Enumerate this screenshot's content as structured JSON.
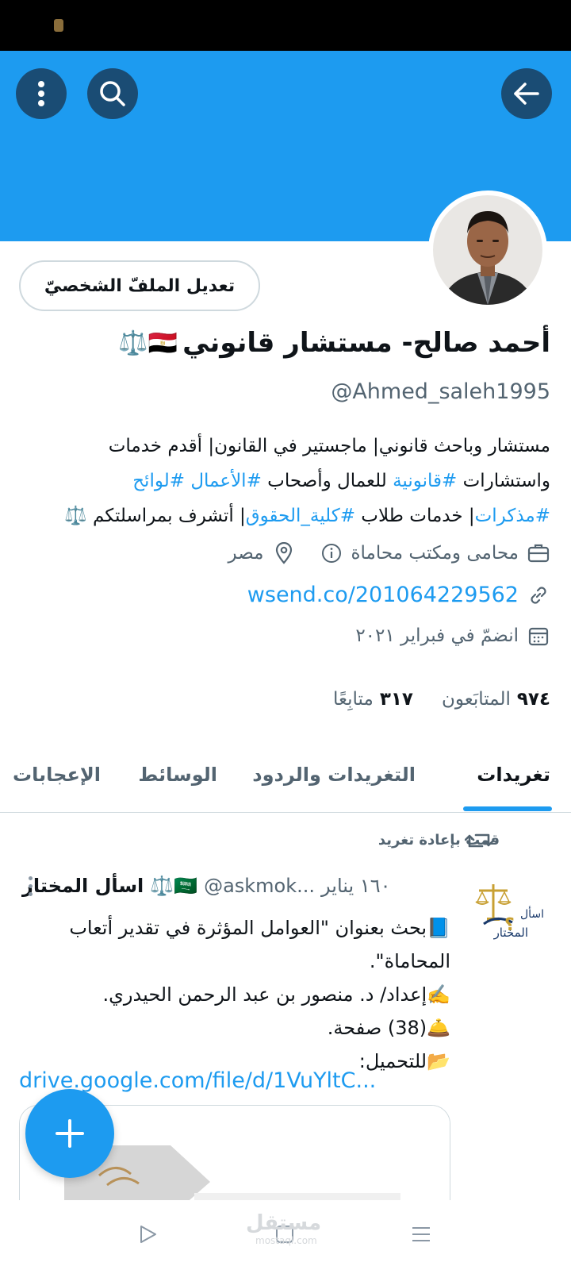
{
  "profile": {
    "name": "أحمد صالح- مستشار قانوني",
    "name_emojis": "🇪🇬⚖️",
    "handle": "@Ahmed_saleh1995",
    "edit_label": "تعديل الملفّ الشخصيّ",
    "bio_line1": "مستشار وباحث قانوني| ماجستير في القانون| أقدم خدمات",
    "bio_line2_a": "واستشارات ",
    "bio_line2_tag1": "#قانونية",
    "bio_line2_b": " للعمال وأصحاب ",
    "bio_line2_tag2": "#الأعمال",
    "bio_line2_c": " ",
    "bio_line2_tag3": "#لوائح",
    "bio_line3_tag1": "#مذكرات",
    "bio_line3_a": "| خدمات طلاب ",
    "bio_line3_tag2": "#كلية_الحقوق",
    "bio_line3_b": "| أتشرف بمراسلتكم ⚖️",
    "category": "محامى ومكتب محاماة",
    "location": "مصر",
    "link": "wsend.co/201064229562",
    "joined": "انضمّ في فبراير ٢٠٢١",
    "followers_count": "٩٧٤",
    "followers_label": "المتابَعون",
    "following_count": "٣١٧",
    "following_label": "متابِعًا"
  },
  "tabs": [
    "تغريدات",
    "التغريدات والردود",
    "الوسائط",
    "الإعجابات"
  ],
  "tweet": {
    "retweet_label": "قمت بإعادة تغريد",
    "author_name": "اسأل المختار",
    "author_emojis": "🇸🇦⚖️",
    "author_handle": "@askmok...",
    "time": "١٦٠ يناير",
    "line1": "📘بحث بعنوان \"العوامل المؤثرة في تقدير أتعاب",
    "line2": "المحاماة\".",
    "line3": "✍️إعداد/ د. منصور بن عبد الرحمن الحيدري.",
    "line4": "🛎️(38) صفحة.",
    "line5": "📂للتحميل:",
    "link": "drive.google.com/file/d/1VuYltC...",
    "avatar_text": "اسأل المختار"
  },
  "watermark": {
    "text": "مستقل",
    "sub": "mostaql.com"
  },
  "colors": {
    "accent": "#1d9bf0",
    "banner_button": "#1a4c74",
    "muted": "#536471"
  }
}
